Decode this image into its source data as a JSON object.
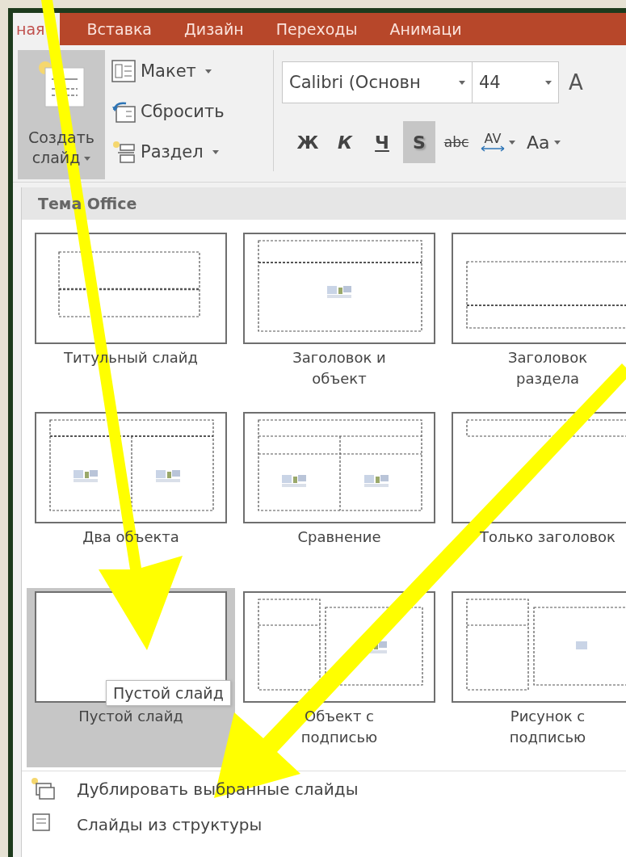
{
  "tabs": [
    {
      "label": "ная",
      "selected": true
    },
    {
      "label": "Вставка",
      "selected": false
    },
    {
      "label": "Дизайн",
      "selected": false
    },
    {
      "label": "Переходы",
      "selected": false
    },
    {
      "label": "Анимаци",
      "selected": false
    }
  ],
  "ribbon": {
    "new_slide": {
      "label": "Создать слайд",
      "pressed": true
    },
    "slide_commands": [
      {
        "label": "Макет",
        "dropdown": true
      },
      {
        "label": "Сбросить",
        "dropdown": false
      },
      {
        "label": "Раздел",
        "dropdown": true
      }
    ],
    "font": {
      "name": "Calibri (Основн",
      "size": "44",
      "grow_label": "A"
    },
    "format_buttons": [
      {
        "label": "Ж",
        "kind": "bold",
        "on": false
      },
      {
        "label": "К",
        "kind": "italic",
        "on": false
      },
      {
        "label": "Ч",
        "kind": "underline",
        "on": false
      },
      {
        "label": "S",
        "kind": "shadow",
        "on": true
      },
      {
        "label": "abc",
        "kind": "strike",
        "on": false
      },
      {
        "label": "AV",
        "kind": "spacing",
        "on": false
      },
      {
        "label": "Aa",
        "kind": "case",
        "on": false
      }
    ]
  },
  "gallery": {
    "title": "Тема Office",
    "layouts": [
      {
        "name": "Титульный слайд",
        "kind": "title",
        "selected": false
      },
      {
        "name": "Заголовок и объект",
        "kind": "title_content",
        "selected": false
      },
      {
        "name": "Заголовок раздела",
        "kind": "section",
        "selected": false
      },
      {
        "name": "Два объекта",
        "kind": "two_content",
        "selected": false
      },
      {
        "name": "Сравнение",
        "kind": "comparison",
        "selected": false
      },
      {
        "name": "Только заголовок",
        "kind": "title_only",
        "selected": false
      },
      {
        "name": "Пустой слайд",
        "kind": "blank",
        "selected": true
      },
      {
        "name": "Объект с подписью",
        "kind": "content_caption",
        "selected": false
      },
      {
        "name": "Рисунок с подписью",
        "kind": "picture_caption",
        "selected": false
      }
    ],
    "tooltip": "Пустой слайд"
  },
  "menu_items": [
    {
      "label": "Дублировать выбранные слайды"
    },
    {
      "label": "Слайды из структуры"
    }
  ]
}
